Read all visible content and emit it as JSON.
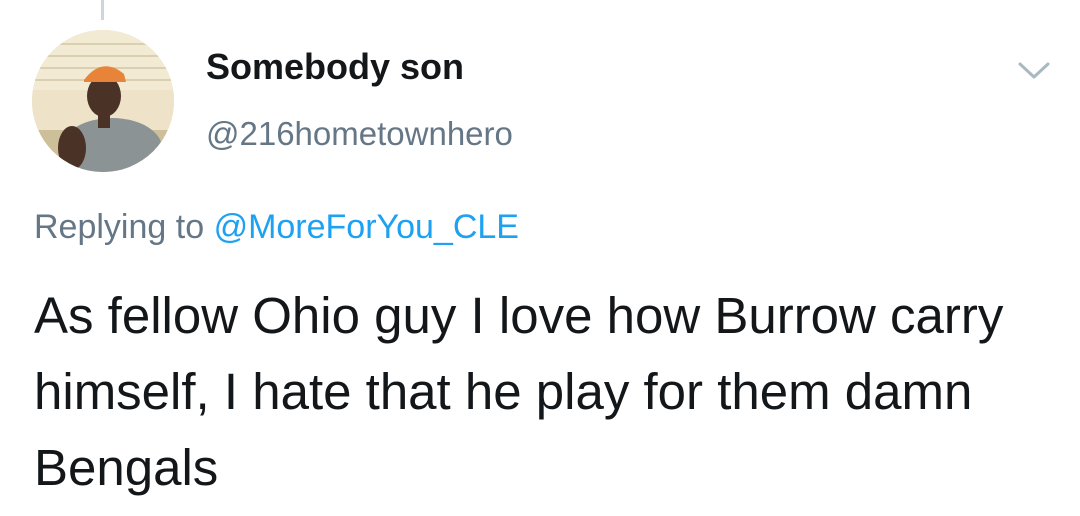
{
  "tweet": {
    "author": {
      "display_name": "Somebody son",
      "handle": "@216hometownhero",
      "avatar_icon": "user-photo-avatar"
    },
    "reply": {
      "prefix": "Replying to",
      "mention": "@MoreForYou_CLE"
    },
    "text": "As fellow Ohio guy I love how Burrow carry himself, I hate that he play for them damn Bengals",
    "menu_icon": "chevron-down-icon"
  },
  "colors": {
    "text_primary": "#14171a",
    "text_secondary": "#657786",
    "link": "#1da1f2",
    "thread_line": "#ccd6dd"
  }
}
